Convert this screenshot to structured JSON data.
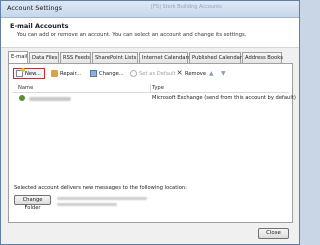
{
  "window": {
    "title": "Account Settings"
  },
  "background_window_title": "[FS] Stork Building Accounts",
  "header": {
    "title": "E-mail Accounts",
    "description": "You can add or remove an account. You can select an account and change its settings."
  },
  "tabs": [
    {
      "label": "E-mail",
      "active": true
    },
    {
      "label": "Data Files",
      "active": false
    },
    {
      "label": "RSS Feeds",
      "active": false
    },
    {
      "label": "SharePoint Lists",
      "active": false
    },
    {
      "label": "Internet Calendars",
      "active": false
    },
    {
      "label": "Published Calendars",
      "active": false
    },
    {
      "label": "Address Books",
      "active": false
    }
  ],
  "toolbar": {
    "new": "New...",
    "repair": "Repair...",
    "change": "Change...",
    "set_default": "Set as Default",
    "remove": "Remove"
  },
  "accounts_list": {
    "columns": [
      "Name",
      "Type"
    ],
    "rows": [
      {
        "type": "Microsoft Exchange (send from this account by default)"
      }
    ]
  },
  "delivery": {
    "text": "Selected account delivers new messages to the following location:",
    "change_folder": "Change Folder"
  },
  "footer": {
    "close": "Close"
  },
  "colors": {
    "highlight": "#e02020",
    "title_bar": "#c6d7ec"
  }
}
